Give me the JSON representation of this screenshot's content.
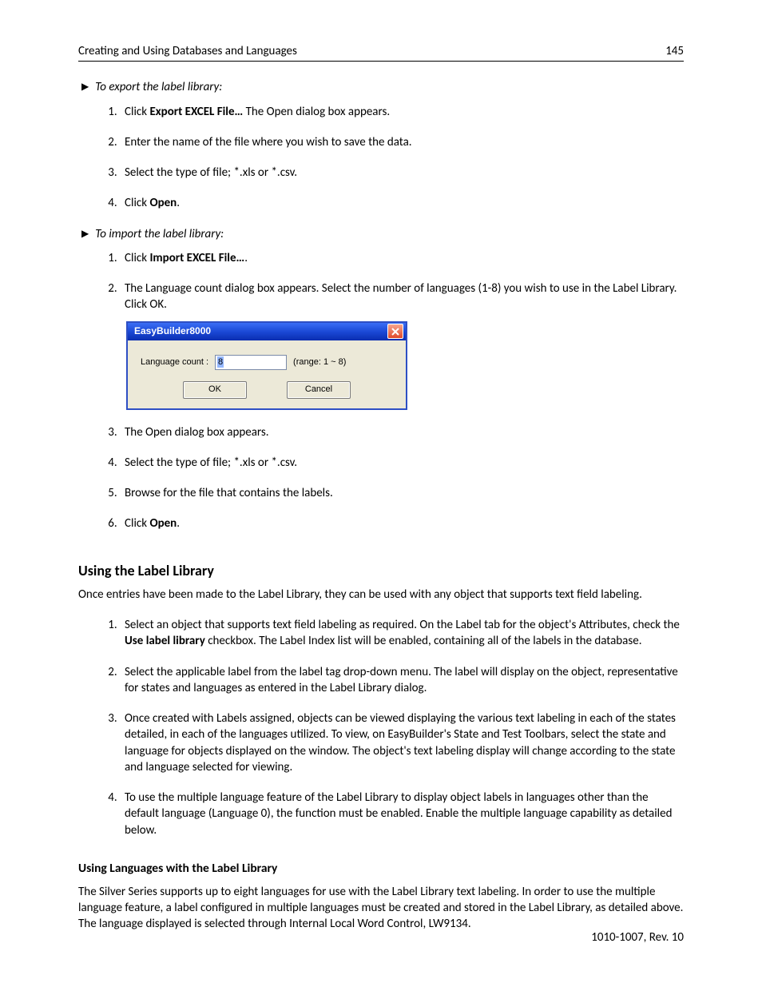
{
  "header": {
    "chapter": "Creating and Using Databases and Languages",
    "page_no": "145"
  },
  "export_section": {
    "heading": "To export the label library:",
    "steps": [
      {
        "pre": "Click ",
        "bold": "Export EXCEL File…",
        "post": " The Open dialog box appears."
      },
      {
        "pre": "Enter the name of the file where you wish to save the data.",
        "bold": "",
        "post": ""
      },
      {
        "pre": "Select the type of file; *.xls or *.csv.",
        "bold": "",
        "post": ""
      },
      {
        "pre": "Click ",
        "bold": "Open",
        "post": "."
      }
    ]
  },
  "import_section": {
    "heading": "To import the label library:",
    "steps_top": [
      {
        "pre": "Click ",
        "bold": "Import EXCEL File…",
        "post": "."
      },
      {
        "pre": "The Language count dialog box appears. Select the number of languages (1-8) you wish to use in the Label Library. Click OK.",
        "bold": "",
        "post": ""
      }
    ],
    "dialog": {
      "title": "EasyBuilder8000",
      "label": "Language count :",
      "value": "8",
      "range": "(range: 1 ~ 8)",
      "ok": "OK",
      "cancel": "Cancel"
    },
    "steps_bottom": [
      {
        "n": "3",
        "pre": "The Open dialog box appears.",
        "bold": "",
        "post": ""
      },
      {
        "n": "4",
        "pre": "Select the type of file; *.xls or *.csv.",
        "bold": "",
        "post": ""
      },
      {
        "n": "5",
        "pre": "Browse for the file that contains the labels.",
        "bold": "",
        "post": ""
      },
      {
        "n": "6",
        "pre": "Click ",
        "bold": "Open",
        "post": "."
      }
    ]
  },
  "using_section": {
    "heading": "Using the Label Library",
    "intro": "Once entries have been made to the Label Library, they can be used with any object that supports text field labeling.",
    "steps": [
      {
        "pre": "Select an object that supports text field labeling as required. On the Label tab for the object's Attributes, check the ",
        "bold": "Use label library",
        "post": " checkbox. The Label Index list will be enabled, containing all of the labels in the database."
      },
      {
        "pre": "Select the applicable label from the label tag drop-down menu. The label will display on the object, representative for states and languages as entered in the Label Library dialog.",
        "bold": "",
        "post": ""
      },
      {
        "pre": "Once created with Labels assigned, objects can be viewed displaying the various text labeling in each of the states detailed, in each of the languages utilized. To view, on EasyBuilder's State and Test Toolbars, select the state and language for objects displayed on the window. The object's text labeling display will change according to the state and language selected for viewing.",
        "bold": "",
        "post": ""
      },
      {
        "pre": "To use the multiple language feature of the Label Library to display object labels in languages other than the default language (Language 0), the function must be enabled. Enable the multiple language capability as detailed below.",
        "bold": "",
        "post": ""
      }
    ]
  },
  "languages_section": {
    "heading": "Using Languages with the Label Library",
    "body": "The Silver Series supports up to eight languages for use with the Label Library text labeling. In order to use the multiple language feature, a label configured in multiple languages must be created and stored in the Label Library, as detailed above. The language displayed is selected through Internal Local Word Control, LW9134."
  },
  "footer": {
    "rev": "1010-1007, Rev. 10"
  }
}
